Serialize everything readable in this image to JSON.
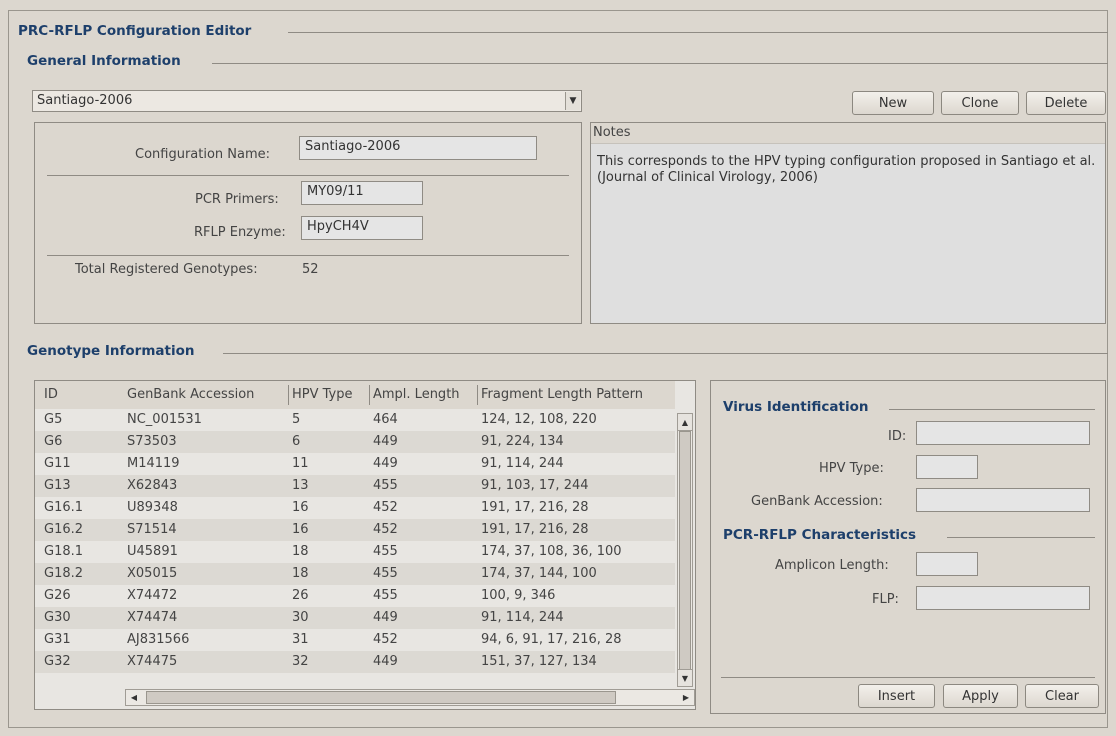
{
  "window": {
    "title": "PRC-RFLP Configuration Editor"
  },
  "general": {
    "section_title": "General Information",
    "selected_config": "Santiago-2006",
    "buttons": {
      "new": "New",
      "clone": "Clone",
      "delete": "Delete"
    },
    "config_name_label": "Configuration Name:",
    "config_name_value": "Santiago-2006",
    "pcr_primers_label": "PCR Primers:",
    "pcr_primers_value": "MY09/11",
    "rflp_enzyme_label": "RFLP Enzyme:",
    "rflp_enzyme_value": "HpyCH4V",
    "total_genotypes_label": "Total Registered Genotypes:",
    "total_genotypes_value": "52",
    "notes_label": "Notes",
    "notes_text": "This corresponds to the HPV typing configuration proposed in Santiago et al. (Journal of Clinical Virology, 2006)"
  },
  "genotype": {
    "section_title": "Genotype Information",
    "columns": [
      "ID",
      "GenBank Accession",
      "HPV Type",
      "Ampl. Length",
      "Fragment Length Pattern"
    ],
    "rows": [
      [
        "G5",
        "NC_001531",
        "5",
        "464",
        "124, 12, 108, 220"
      ],
      [
        "G6",
        "S73503",
        "6",
        "449",
        "91, 224, 134"
      ],
      [
        "G11",
        "M14119",
        "11",
        "449",
        "91, 114, 244"
      ],
      [
        "G13",
        "X62843",
        "13",
        "455",
        "91, 103, 17, 244"
      ],
      [
        "G16.1",
        "U89348",
        "16",
        "452",
        "191, 17, 216, 28"
      ],
      [
        "G16.2",
        "S71514",
        "16",
        "452",
        "191, 17, 216, 28"
      ],
      [
        "G18.1",
        "U45891",
        "18",
        "455",
        "174, 37, 108, 36, 100"
      ],
      [
        "G18.2",
        "X05015",
        "18",
        "455",
        "174, 37, 144, 100"
      ],
      [
        "G26",
        "X74472",
        "26",
        "455",
        "100, 9, 346"
      ],
      [
        "G30",
        "X74474",
        "30",
        "449",
        "91, 114, 244"
      ],
      [
        "G31",
        "AJ831566",
        "31",
        "452",
        "94, 6, 91, 17, 216, 28"
      ],
      [
        "G32",
        "X74475",
        "32",
        "449",
        "151, 37, 127, 134"
      ]
    ]
  },
  "virus": {
    "section_title": "Virus Identification",
    "id_label": "ID:",
    "id_value": "",
    "hpv_type_label": "HPV Type:",
    "hpv_type_value": "",
    "genbank_label": "GenBank Accession:",
    "genbank_value": ""
  },
  "pcr": {
    "section_title": "PCR-RFLP Characteristics",
    "amplicon_label": "Amplicon Length:",
    "amplicon_value": "",
    "flp_label": "FLP:",
    "flp_value": ""
  },
  "actions": {
    "insert": "Insert",
    "apply": "Apply",
    "clear": "Clear"
  }
}
